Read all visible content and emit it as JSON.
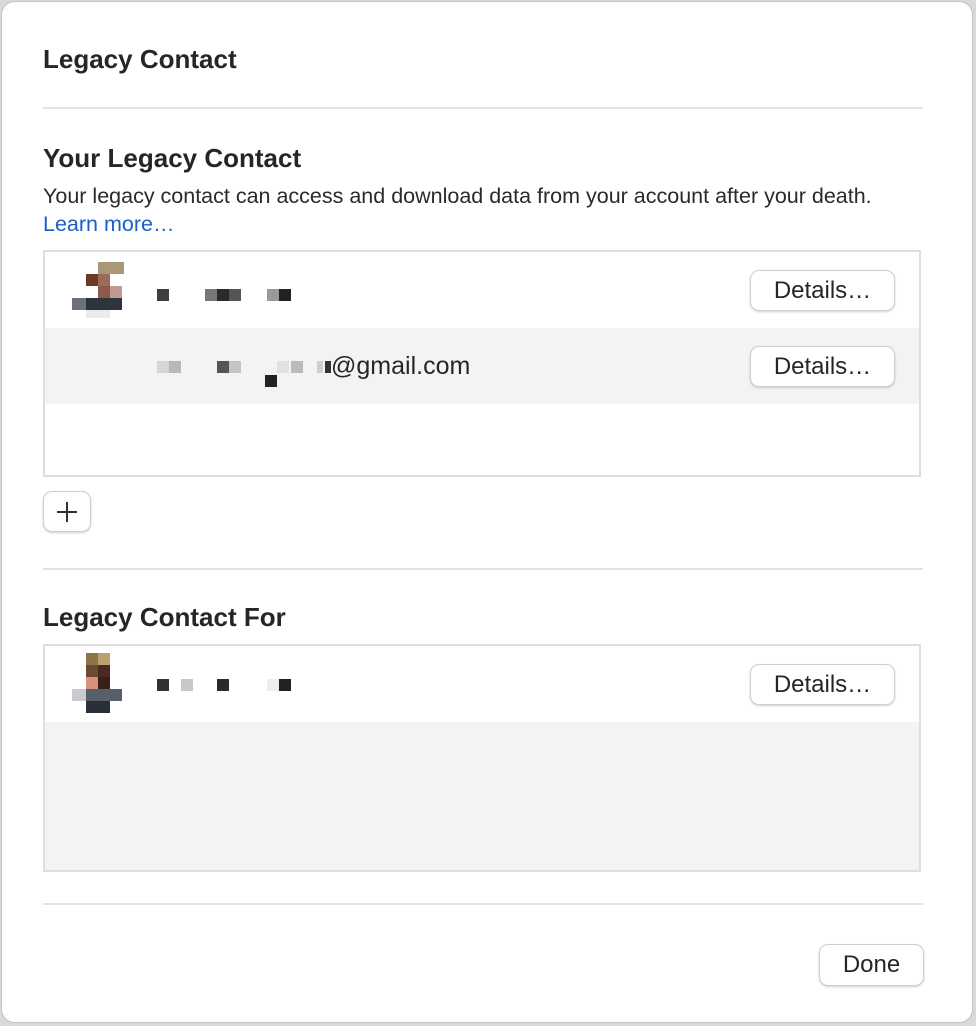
{
  "window": {
    "title": "Legacy Contact"
  },
  "your_legacy_contact": {
    "heading": "Your Legacy Contact",
    "description": "Your legacy contact can access and download data from your account after your death.",
    "learn_more": "Learn more…",
    "rows": [
      {
        "details_label": "Details…"
      },
      {
        "email_suffix": "@gmail.com",
        "details_label": "Details…"
      }
    ],
    "add_icon": "plus-icon"
  },
  "legacy_contact_for": {
    "heading": "Legacy Contact For",
    "rows": [
      {
        "details_label": "Details…"
      }
    ]
  },
  "footer": {
    "done_label": "Done"
  },
  "colors": {
    "link": "#1a5fc7",
    "alt_row": "#f2f3f3",
    "separator": "#e3e3e3"
  }
}
